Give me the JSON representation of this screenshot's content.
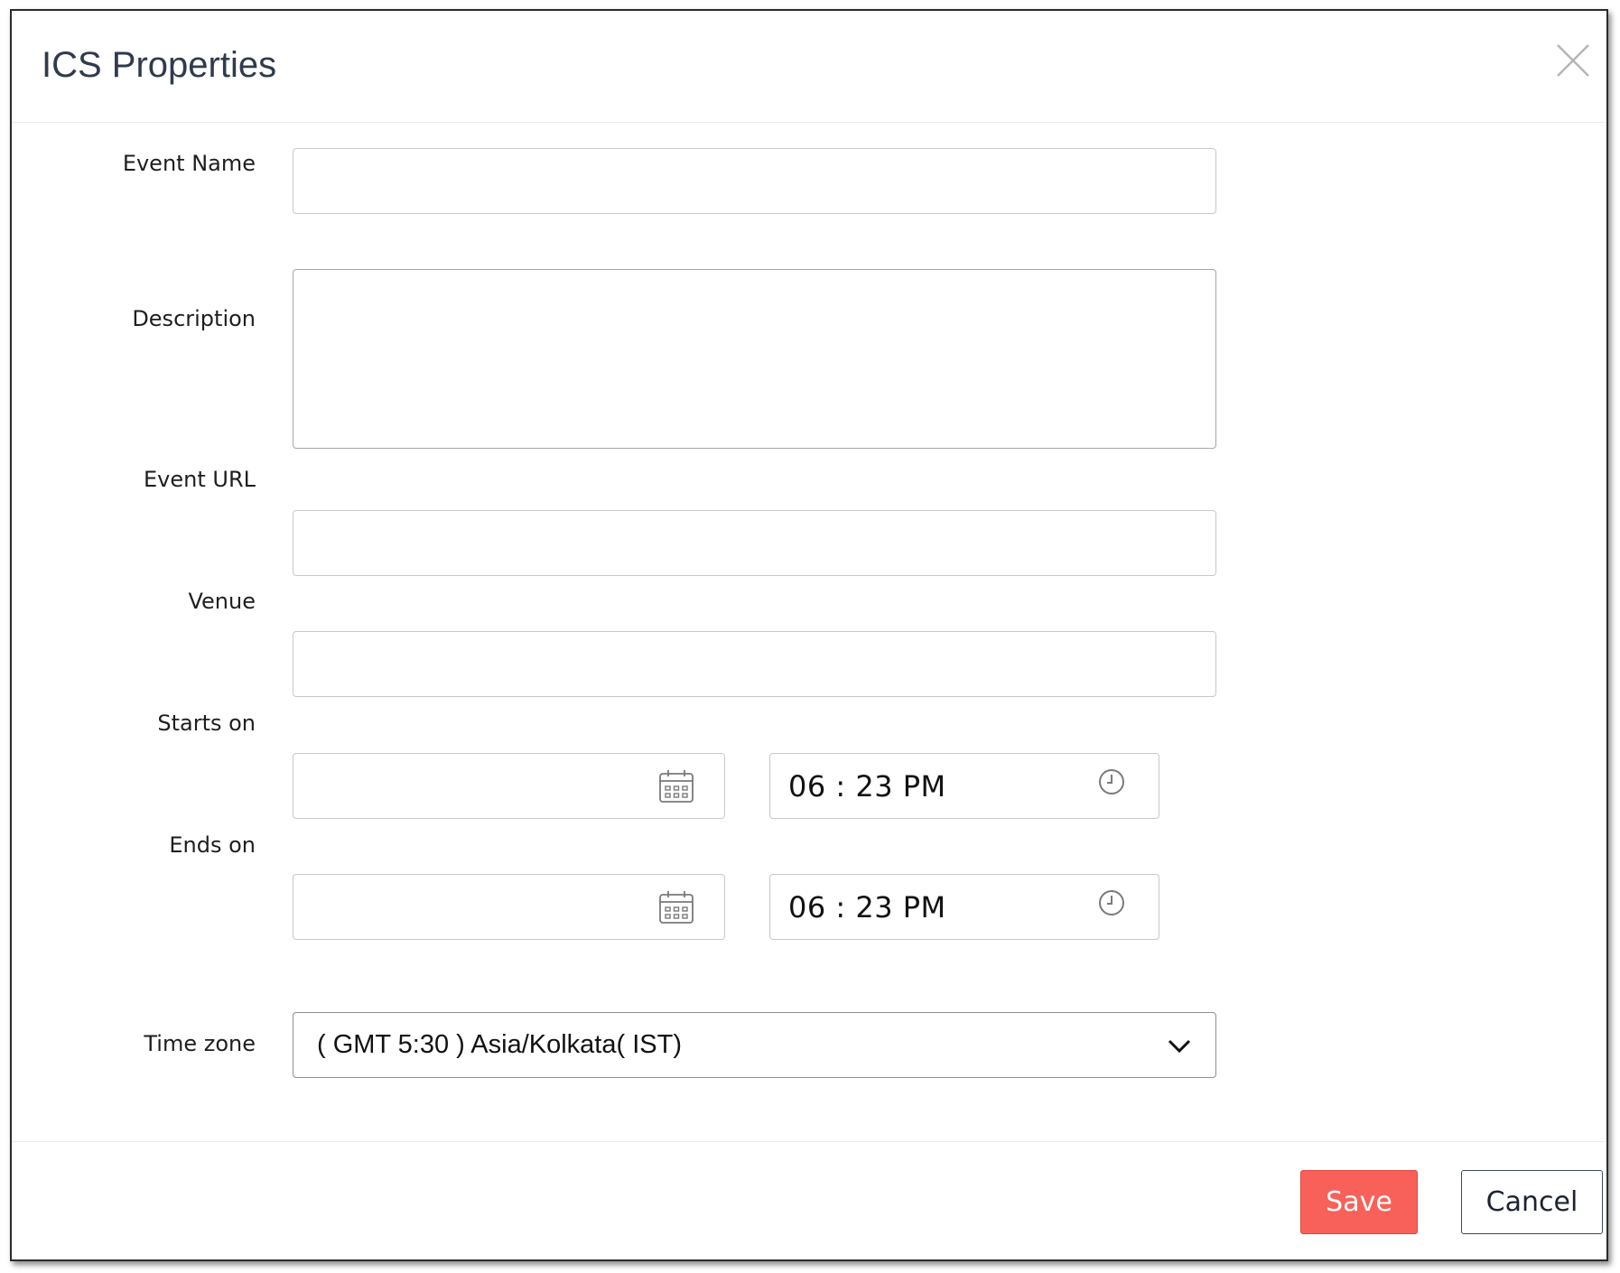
{
  "dialog": {
    "title": "ICS Properties",
    "close_icon": "close-icon"
  },
  "form": {
    "event_name": {
      "label": "Event Name",
      "value": "",
      "placeholder": ""
    },
    "description": {
      "label": "Description",
      "value": "",
      "placeholder": ""
    },
    "event_url": {
      "label": "Event URL",
      "value": "",
      "placeholder": ""
    },
    "venue": {
      "label": "Venue",
      "value": "",
      "placeholder": ""
    },
    "starts_on": {
      "label": "Starts on",
      "date_value": "",
      "time_value": "06 : 23 PM",
      "date_icon": "calendar-icon",
      "time_icon": "clock-icon"
    },
    "ends_on": {
      "label": "Ends on",
      "date_value": "",
      "time_value": "06 : 23 PM",
      "date_icon": "calendar-icon",
      "time_icon": "clock-icon"
    },
    "time_zone": {
      "label": "Time zone",
      "selected": "( GMT 5:30 ) Asia/Kolkata( IST)",
      "icon": "chevron-down-icon"
    }
  },
  "footer": {
    "save_label": "Save",
    "cancel_label": "Cancel"
  },
  "colors": {
    "save_button_bg": "#f76159",
    "title_text": "#2f3b4d",
    "cancel_border": "#3c4a5c"
  }
}
